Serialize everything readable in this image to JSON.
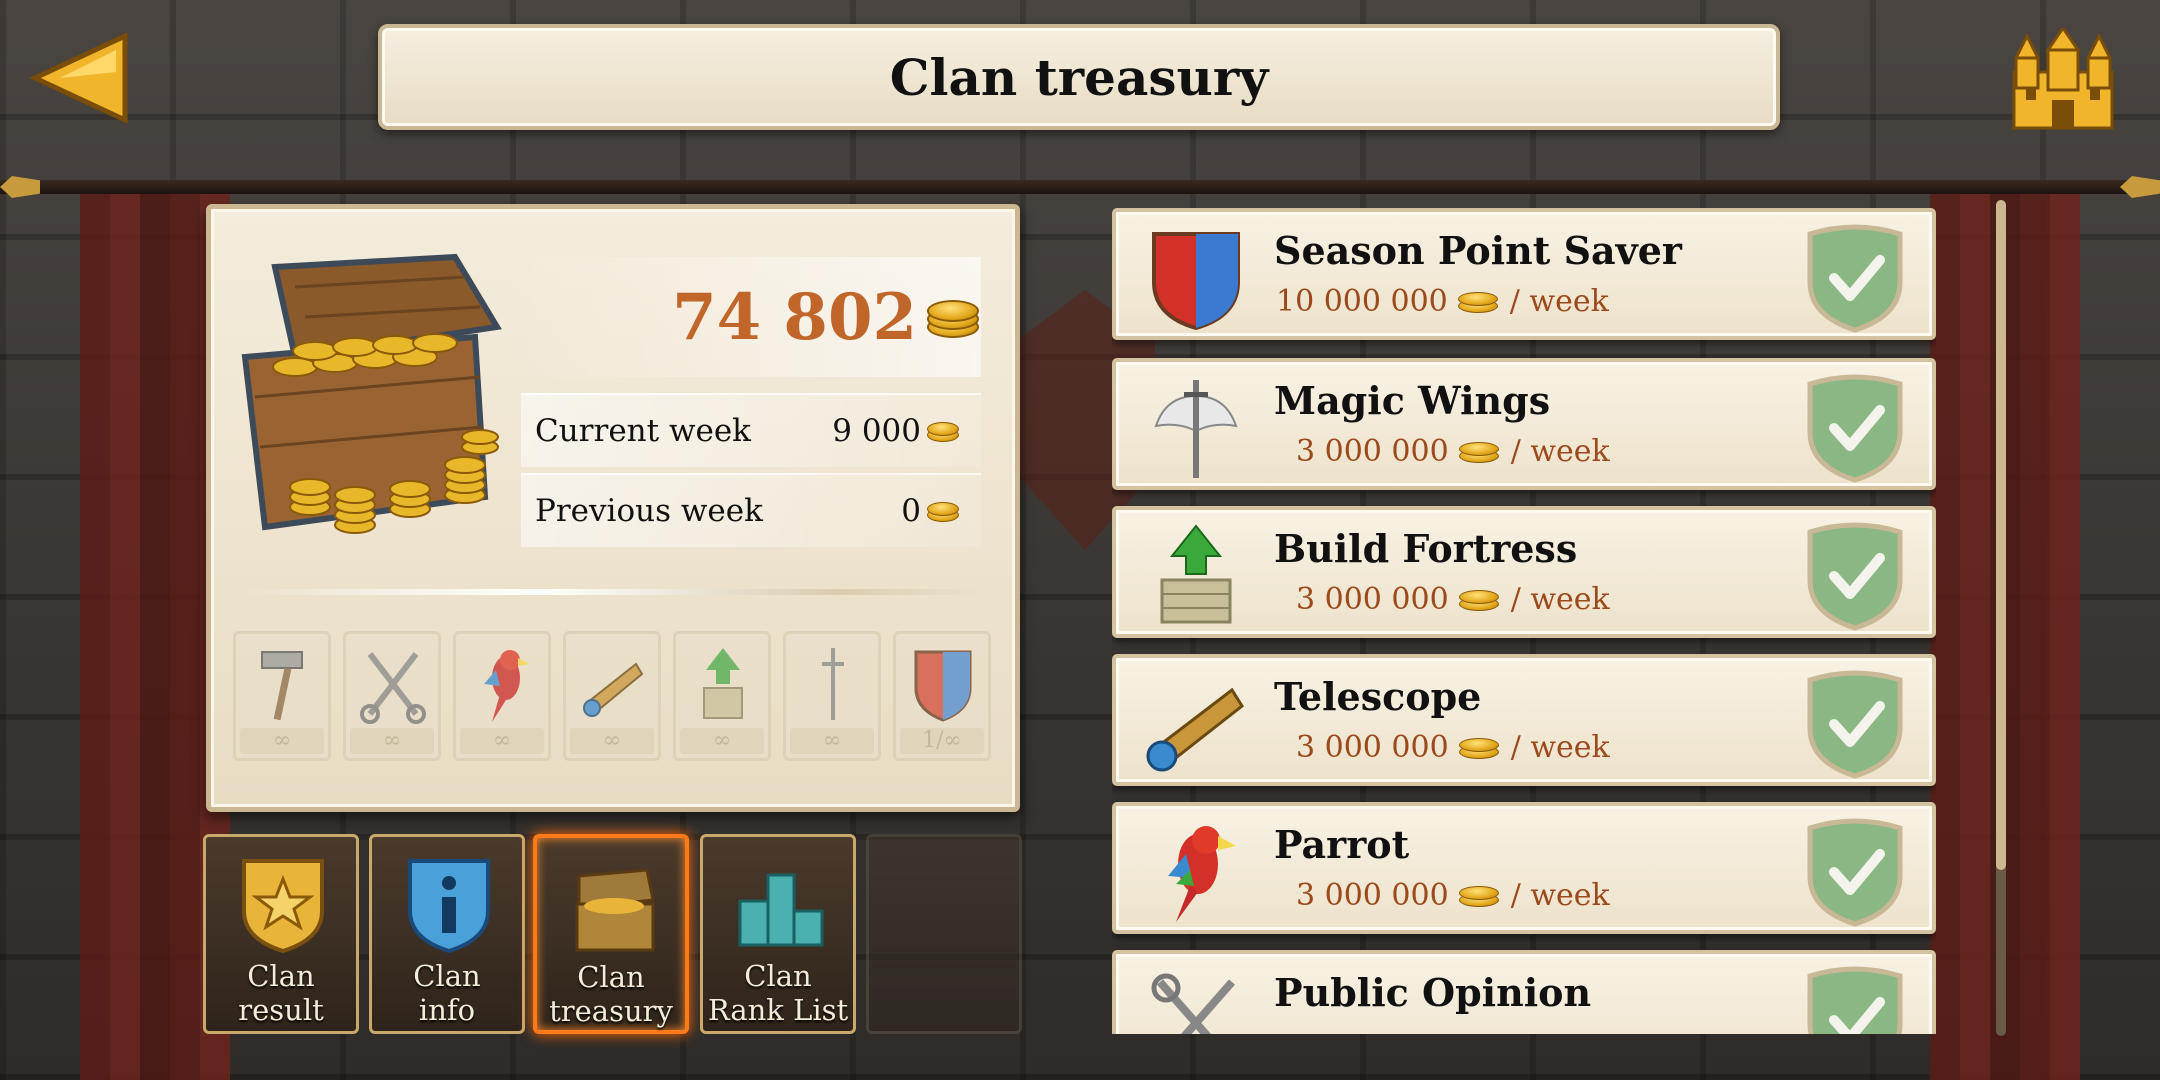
{
  "header": {
    "title": "Clan treasury"
  },
  "treasury": {
    "total": "74 802",
    "rows": [
      {
        "label": "Current week",
        "value": "9 000"
      },
      {
        "label": "Previous week",
        "value": "0"
      }
    ],
    "bonus_slots": [
      {
        "icon": "hammer-icon",
        "count": "∞"
      },
      {
        "icon": "tools-icon",
        "count": "∞"
      },
      {
        "icon": "parrot-icon",
        "count": "∞"
      },
      {
        "icon": "telescope-icon",
        "count": "∞"
      },
      {
        "icon": "fortress-icon",
        "count": "∞"
      },
      {
        "icon": "wings-icon",
        "count": "∞"
      },
      {
        "icon": "shield-icon",
        "count": "1/∞"
      }
    ]
  },
  "nav": [
    {
      "label_1": "Clan",
      "label_2": "result",
      "icon": "star-badge-icon"
    },
    {
      "label_1": "Clan",
      "label_2": "info",
      "icon": "info-badge-icon"
    },
    {
      "label_1": "Clan",
      "label_2": "treasury",
      "icon": "treasure-chest-icon",
      "active": true
    },
    {
      "label_1": "Clan",
      "label_2": "Rank List",
      "icon": "podium-icon"
    }
  ],
  "bonuses": [
    {
      "name": "Season Point Saver",
      "cost": "10 000 000",
      "period": "/ week",
      "icon": "shield-icon",
      "purchased": true
    },
    {
      "name": "Magic Wings",
      "cost": "3 000 000",
      "period": "/ week",
      "icon": "winged-sword-icon",
      "purchased": true
    },
    {
      "name": "Build Fortress",
      "cost": "3 000 000",
      "period": "/ week",
      "icon": "fortress-icon",
      "purchased": true
    },
    {
      "name": "Telescope",
      "cost": "3 000 000",
      "period": "/ week",
      "icon": "telescope-icon",
      "purchased": true
    },
    {
      "name": "Parrot",
      "cost": "3 000 000",
      "period": "/ week",
      "icon": "parrot-icon",
      "purchased": true
    },
    {
      "name": "Public Opinion",
      "cost": "",
      "period": "",
      "icon": "tools-icon",
      "purchased": true
    }
  ],
  "colors": {
    "accent": "#ff7b1a",
    "cost_text": "#9a4a1c",
    "total_text": "#c0662a",
    "check_shield": "#8bb784"
  }
}
